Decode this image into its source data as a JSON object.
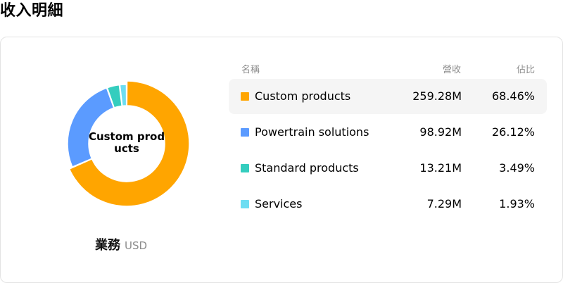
{
  "page": {
    "title": "收入明細"
  },
  "donut": {
    "center_label": "Custom products",
    "caption": "業務",
    "unit": "USD"
  },
  "table": {
    "headers": {
      "name": "名稱",
      "revenue": "營收",
      "share": "佔比"
    },
    "rows": [
      {
        "name": "Custom products",
        "revenue": "259.28M",
        "share": "68.46%",
        "color": "#FFA500",
        "active": true
      },
      {
        "name": "Powertrain solutions",
        "revenue": "98.92M",
        "share": "26.12%",
        "color": "#5B9BFF",
        "active": false
      },
      {
        "name": "Standard products",
        "revenue": "13.21M",
        "share": "3.49%",
        "color": "#34CDBE",
        "active": false
      },
      {
        "name": "Services",
        "revenue": "7.29M",
        "share": "1.93%",
        "color": "#6DDDF2",
        "active": false
      }
    ]
  },
  "chart_data": {
    "type": "pie",
    "categories": [
      "Custom products",
      "Powertrain solutions",
      "Standard products",
      "Services"
    ],
    "values": [
      259.28,
      98.92,
      13.21,
      7.29
    ],
    "percentages": [
      68.46,
      26.12,
      3.49,
      1.93
    ],
    "colors": [
      "#FFA500",
      "#5B9BFF",
      "#34CDBE",
      "#6DDDF2"
    ],
    "highlighted": "Custom products",
    "unit": "USD"
  }
}
